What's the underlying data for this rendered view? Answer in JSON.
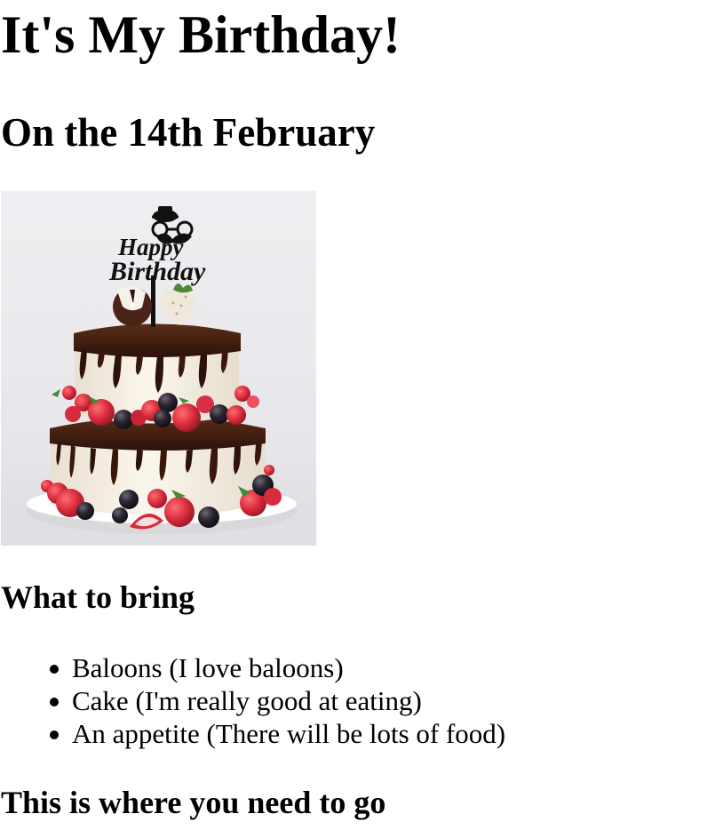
{
  "header": {
    "title": "It's My Birthday!",
    "date_line": "On the 14th February"
  },
  "image": {
    "alt": "",
    "topper_text": "Happy Birthday",
    "icon": "birthday-cake-image"
  },
  "bring_section": {
    "heading": "What to bring",
    "items": [
      "Baloons (I love baloons)",
      "Cake (I'm really good at eating)",
      "An appetite (There will be lots of food)"
    ]
  },
  "directions_section": {
    "heading": "This is where you need to go"
  },
  "colors": {
    "text": "#000000",
    "background": "#ffffff",
    "cake_chocolate": "#3a1b10",
    "cake_cream": "#f5eee2",
    "strawberry": "#d9263a",
    "blackberry": "#1f1a22",
    "image_background": "#e9e8ec"
  }
}
